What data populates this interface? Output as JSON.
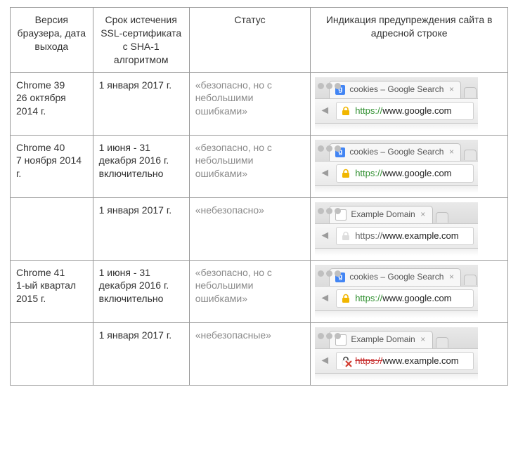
{
  "headers": {
    "col1": "Версия браузера, дата выхода",
    "col2": "Срок истечения SSL-сертификата с SHA-1 алгоритмом",
    "col3": "Статус",
    "col4": "Индикация предупреждения сайта в адресной строке"
  },
  "rows": [
    {
      "version_name": "Chrome 39",
      "version_date": "26 октября 2014 г.",
      "expiry": "1 января 2017 г.",
      "status": "«безопасно, но с небольшими ошибками»",
      "shot": {
        "tab_icon": "google",
        "tab_title": "cookies – Google Search",
        "lock": "yellow",
        "scheme": "https://",
        "scheme_style": "ok",
        "host": "www.google.com"
      }
    },
    {
      "version_name": "Chrome 40",
      "version_date": "7 ноября 2014 г.",
      "expiry": "1 июня - 31 декабря 2016 г. включительно",
      "status": "«безопасно, но с небольшими ошибками»",
      "shot": {
        "tab_icon": "google",
        "tab_title": "cookies – Google Search",
        "lock": "yellow",
        "scheme": "https://",
        "scheme_style": "ok",
        "host": "www.google.com"
      }
    },
    {
      "version_name": "",
      "version_date": "",
      "expiry": "1 января 2017 г.",
      "status": "«небезопасно»",
      "shot": {
        "tab_icon": "plain",
        "tab_title": "Example Domain",
        "lock": "plain",
        "scheme": "https://",
        "scheme_style": "none",
        "host": "www.example.com"
      }
    },
    {
      "version_name": "Chrome 41",
      "version_date": "1-ый квартал 2015 г.",
      "expiry": "1 июня - 31 декабря 2016 г. включительно",
      "status": "«безопасно, но с небольшими ошибками»",
      "shot": {
        "tab_icon": "google",
        "tab_title": "cookies – Google Search",
        "lock": "yellow",
        "scheme": "https://",
        "scheme_style": "ok",
        "host": "www.google.com"
      }
    },
    {
      "version_name": "",
      "version_date": "",
      "expiry": "1 января 2017 г.",
      "status": "«небезопасные»",
      "shot": {
        "tab_icon": "plain",
        "tab_title": "Example Domain",
        "lock": "red",
        "scheme": "https://",
        "scheme_style": "strike",
        "host": "www.example.com"
      }
    }
  ],
  "glyphs": {
    "close_x": "×",
    "back": "◄",
    "google_g": "g"
  }
}
